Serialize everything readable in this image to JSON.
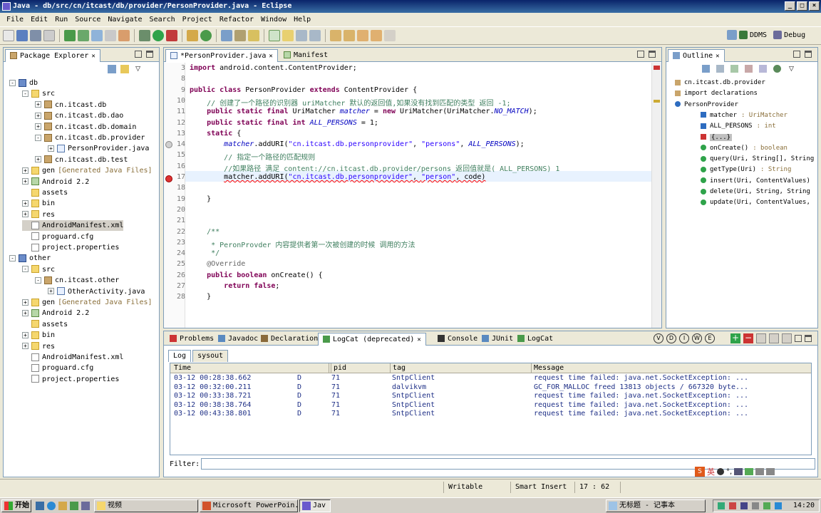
{
  "window": {
    "title": "Java - db/src/cn/itcast/db/provider/PersonProvider.java - Eclipse"
  },
  "menu": [
    "File",
    "Edit",
    "Run",
    "Source",
    "Navigate",
    "Search",
    "Project",
    "Refactor",
    "Window",
    "Help"
  ],
  "perspectives": {
    "ddms": "DDMS",
    "debug": "Debug"
  },
  "package_explorer": {
    "title": "Package Explorer",
    "items": [
      {
        "label": "db",
        "indent": 0,
        "icon": "proj",
        "exp": "-"
      },
      {
        "label": "src",
        "indent": 1,
        "icon": "folder",
        "exp": "-"
      },
      {
        "label": "cn.itcast.db",
        "indent": 2,
        "icon": "pkg",
        "exp": "+"
      },
      {
        "label": "cn.itcast.db.dao",
        "indent": 2,
        "icon": "pkg",
        "exp": "+"
      },
      {
        "label": "cn.itcast.db.domain",
        "indent": 2,
        "icon": "pkg",
        "exp": "+"
      },
      {
        "label": "cn.itcast.db.provider",
        "indent": 2,
        "icon": "pkg",
        "exp": "-"
      },
      {
        "label": "PersonProvider.java",
        "indent": 3,
        "icon": "java",
        "exp": "+"
      },
      {
        "label": "cn.itcast.db.test",
        "indent": 2,
        "icon": "pkg",
        "exp": "+"
      },
      {
        "label": "gen",
        "indent": 1,
        "icon": "folder",
        "exp": "+",
        "suffix": "[Generated Java Files]"
      },
      {
        "label": "Android 2.2",
        "indent": 1,
        "icon": "lib",
        "exp": "+"
      },
      {
        "label": "assets",
        "indent": 1,
        "icon": "folder",
        "exp": ""
      },
      {
        "label": "bin",
        "indent": 1,
        "icon": "folder",
        "exp": "+"
      },
      {
        "label": "res",
        "indent": 1,
        "icon": "folder",
        "exp": "+"
      },
      {
        "label": "AndroidManifest.xml",
        "indent": 1,
        "icon": "file",
        "exp": "",
        "selected": true
      },
      {
        "label": "proguard.cfg",
        "indent": 1,
        "icon": "file",
        "exp": ""
      },
      {
        "label": "project.properties",
        "indent": 1,
        "icon": "file",
        "exp": ""
      },
      {
        "label": "other",
        "indent": 0,
        "icon": "proj",
        "exp": "-"
      },
      {
        "label": "src",
        "indent": 1,
        "icon": "folder",
        "exp": "-"
      },
      {
        "label": "cn.itcast.other",
        "indent": 2,
        "icon": "pkg",
        "exp": "-"
      },
      {
        "label": "OtherActivity.java",
        "indent": 3,
        "icon": "java",
        "exp": "+"
      },
      {
        "label": "gen",
        "indent": 1,
        "icon": "folder",
        "exp": "+",
        "suffix": "[Generated Java Files]"
      },
      {
        "label": "Android 2.2",
        "indent": 1,
        "icon": "lib",
        "exp": "+"
      },
      {
        "label": "assets",
        "indent": 1,
        "icon": "folder",
        "exp": ""
      },
      {
        "label": "bin",
        "indent": 1,
        "icon": "folder",
        "exp": "+"
      },
      {
        "label": "res",
        "indent": 1,
        "icon": "folder",
        "exp": "+"
      },
      {
        "label": "AndroidManifest.xml",
        "indent": 1,
        "icon": "file",
        "exp": ""
      },
      {
        "label": "proguard.cfg",
        "indent": 1,
        "icon": "file",
        "exp": ""
      },
      {
        "label": "project.properties",
        "indent": 1,
        "icon": "file",
        "exp": ""
      }
    ]
  },
  "editor": {
    "tabs": [
      {
        "label": "*PersonProvider.java",
        "active": true
      },
      {
        "label": "Manifest",
        "active": false
      }
    ],
    "lines": [
      {
        "n": "3",
        "html": "<span class=\"kw\">import</span> android.content.ContentProvider;"
      },
      {
        "n": "8",
        "html": ""
      },
      {
        "n": "9",
        "html": "<span class=\"kw\">public class</span> PersonProvider <span class=\"kw\">extends</span> ContentProvider {"
      },
      {
        "n": "10",
        "html": "    <span class=\"cm\">// 创建了一个路径的识别器 uriMatcher 默认的返回值,如果没有找到匹配的类型 返回 -1;</span>"
      },
      {
        "n": "11",
        "html": "    <span class=\"kw\">public static final</span> UriMatcher <span class=\"fld\">matcher</span> = <span class=\"kw\">new</span> UriMatcher(UriMatcher.<span class=\"fld\">NO_MATCH</span>);"
      },
      {
        "n": "12",
        "html": "    <span class=\"kw\">public static final int</span> <span class=\"fld\">ALL_PERSONS</span> = 1;"
      },
      {
        "n": "13",
        "html": "    <span class=\"kw\">static</span> {"
      },
      {
        "n": "14",
        "html": "        <span class=\"fld\">matcher</span>.addURI(<span class=\"st\">\"cn.itcast.db.personprovider\"</span>, <span class=\"st\">\"persons\"</span>, <span class=\"fld\">ALL_PERSONS</span>);"
      },
      {
        "n": "15",
        "html": "        <span class=\"cm\">// 指定一个路径的匹配规则</span>"
      },
      {
        "n": "16",
        "html": "        <span class=\"cm\">//如果路径 满足 content://cn.itcast.db.provider/persons 返回值就是( ALL_PERSONS) 1</span>"
      },
      {
        "n": "17",
        "html": "        <span class=\"err\">matcher.addURI(<span class=\"st\">\"cn.itcast.db.personprovider\"</span>, <span class=\"st\">\"person\"</span>, code)</span>"
      },
      {
        "n": "18",
        "html": ""
      },
      {
        "n": "19",
        "html": "    }"
      },
      {
        "n": "20",
        "html": ""
      },
      {
        "n": "21",
        "html": ""
      },
      {
        "n": "22",
        "html": "    <span class=\"cm\">/**</span>"
      },
      {
        "n": "23",
        "html": "    <span class=\"cm\"> * PeronProvder 内容提供者第一次被创建的时候 调用的方法</span>"
      },
      {
        "n": "24",
        "html": "    <span class=\"cm\"> */</span>"
      },
      {
        "n": "25",
        "html": "    <span class=\"an\">@Override</span>"
      },
      {
        "n": "26",
        "html": "    <span class=\"kw\">public boolean</span> onCreate() {"
      },
      {
        "n": "27",
        "html": "        <span class=\"kw\">return false</span>;"
      },
      {
        "n": "28",
        "html": "    }"
      }
    ]
  },
  "outline": {
    "title": "Outline",
    "items": [
      {
        "label": "cn.itcast.db.provider",
        "type": "",
        "indent": 0,
        "icon": "pkg"
      },
      {
        "label": "import declarations",
        "type": "",
        "indent": 0,
        "icon": "pkg"
      },
      {
        "label": "PersonProvider",
        "type": "",
        "indent": 0,
        "icon": "class"
      },
      {
        "label": "matcher",
        "type": ": UriMatcher",
        "indent": 1,
        "icon": "field"
      },
      {
        "label": "ALL_PERSONS",
        "type": ": int",
        "indent": 1,
        "icon": "field"
      },
      {
        "label": "{...}",
        "type": "",
        "indent": 1,
        "icon": "static"
      },
      {
        "label": "onCreate()",
        "type": ": boolean",
        "indent": 1,
        "icon": "method"
      },
      {
        "label": "query(Uri, String[], String",
        "type": "",
        "indent": 1,
        "icon": "method"
      },
      {
        "label": "getType(Uri)",
        "type": ": String",
        "indent": 1,
        "icon": "method"
      },
      {
        "label": "insert(Uri, ContentValues)",
        "type": "",
        "indent": 1,
        "icon": "method"
      },
      {
        "label": "delete(Uri, String, String",
        "type": "",
        "indent": 1,
        "icon": "method"
      },
      {
        "label": "update(Uri, ContentValues,",
        "type": "",
        "indent": 1,
        "icon": "method"
      }
    ]
  },
  "bottom": {
    "tabs": [
      "Problems",
      "Javadoc",
      "Declaration",
      "LogCat (deprecated)",
      "Console",
      "JUnit",
      "LogCat"
    ],
    "subtabs": [
      "Log",
      "sysout"
    ],
    "columns": [
      "Time",
      "",
      "pid",
      "tag",
      "Message"
    ],
    "rows": [
      [
        "03-12 00:28:38.662",
        "D",
        "71",
        "SntpClient",
        "request time failed: java.net.SocketException: ..."
      ],
      [
        "03-12 00:32:00.211",
        "D",
        "71",
        "dalvikvm",
        "GC_FOR_MALLOC freed 13813 objects / 667320 byte..."
      ],
      [
        "03-12 00:33:38.721",
        "D",
        "71",
        "SntpClient",
        "request time failed: java.net.SocketException: ..."
      ],
      [
        "03-12 00:38:38.764",
        "D",
        "71",
        "SntpClient",
        "request time failed: java.net.SocketException: ..."
      ],
      [
        "03-12 00:43:38.801",
        "D",
        "71",
        "SntpClient",
        "request time failed: java.net.SocketException: ..."
      ]
    ],
    "filter_label": "Filter:",
    "filter_value": ""
  },
  "status": {
    "writable": "Writable",
    "insert_mode": "Smart Insert",
    "position": "17 : 62"
  },
  "taskbar": {
    "start": "开始",
    "buttons": [
      "视频",
      "Microsoft PowerPoin...",
      "Jav",
      "无标题 - 记事本"
    ],
    "ime": "英",
    "clock": "14:20"
  },
  "colors": {
    "titlebar": "#0a246a",
    "keyword": "#7f0055",
    "comment": "#3f7f5f",
    "string": "#2a00ff",
    "field": "#0000c0"
  }
}
